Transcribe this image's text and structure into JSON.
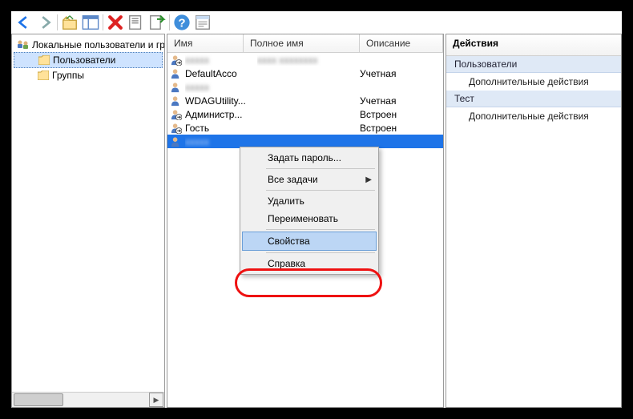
{
  "toolbar": {
    "back": "Назад",
    "forward": "Вперёд",
    "up": "Вверх",
    "show": "Показать/скрыть",
    "delete": "Удалить",
    "refresh": "Обновить",
    "export": "Экспорт",
    "help": "Справка",
    "prop": "Свойства"
  },
  "tree": {
    "root": "Локальные пользователи и группы",
    "users": "Пользователи",
    "groups": "Группы"
  },
  "list": {
    "columns": {
      "name": "Имя",
      "fullname": "Полное имя",
      "desc": "Описание"
    },
    "rows": [
      {
        "name": "",
        "fullname": "",
        "desc": "",
        "blurName": true,
        "blurFull": true,
        "disabled": true
      },
      {
        "name": "DefaultAcco",
        "fullname": "",
        "desc": "Учетная",
        "blurName": false,
        "blurFull": false,
        "disabled": false
      },
      {
        "name": "",
        "fullname": "",
        "desc": "",
        "blurName": true,
        "blurFull": false,
        "disabled": false
      },
      {
        "name": "WDAGUtility...",
        "fullname": "",
        "desc": "Учетная",
        "blurName": false,
        "blurFull": false,
        "disabled": false
      },
      {
        "name": "Администр...",
        "fullname": "",
        "desc": "Встроен",
        "blurName": false,
        "blurFull": false,
        "disabled": true
      },
      {
        "name": "Гость",
        "fullname": "",
        "desc": "Встроен",
        "blurName": false,
        "blurFull": false,
        "disabled": true
      },
      {
        "name": "",
        "fullname": "",
        "desc": "",
        "blurName": true,
        "blurFull": false,
        "disabled": false,
        "selected": true
      }
    ]
  },
  "menu": {
    "set_password": "Задать пароль...",
    "all_tasks": "Все задачи",
    "delete": "Удалить",
    "rename": "Переименовать",
    "properties": "Свойства",
    "help": "Справка"
  },
  "actions": {
    "header": "Действия",
    "group1_title": "Пользователи",
    "group_more": "Дополнительные действия",
    "group2_title": "Тест"
  }
}
